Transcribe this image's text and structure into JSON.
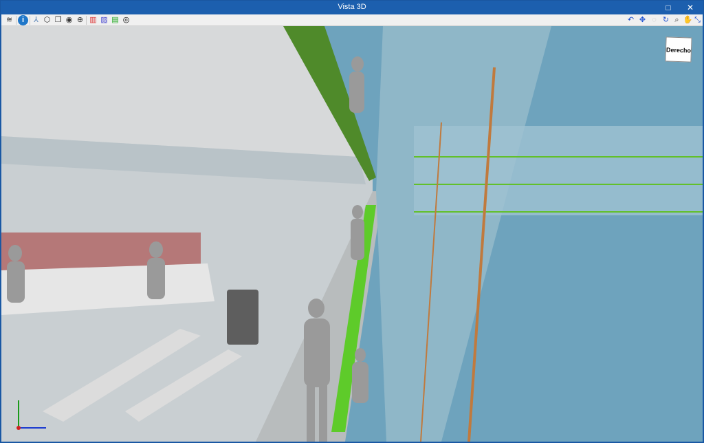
{
  "window": {
    "title": "Vista 3D",
    "maximize_icon": "□",
    "close_icon": "✕"
  },
  "toolbar": {
    "left": [
      {
        "name": "layers-icon",
        "glyph": "≋"
      },
      {
        "name": "info-icon",
        "glyph": "i"
      },
      {
        "name": "axes-icon",
        "glyph": "⅄"
      },
      {
        "name": "box-view-icon",
        "glyph": "⬡"
      },
      {
        "name": "copy-view-icon",
        "glyph": "❐"
      },
      {
        "name": "eye-orbit-icon",
        "glyph": "◉"
      },
      {
        "name": "orbit-icon",
        "glyph": "⊕"
      },
      {
        "name": "section-red-icon",
        "glyph": "▥"
      },
      {
        "name": "section-blue-icon",
        "glyph": "▨"
      },
      {
        "name": "floor-green-icon",
        "glyph": "▤"
      },
      {
        "name": "hide-icon",
        "glyph": "◎"
      }
    ],
    "right": [
      {
        "name": "rotate-zoom-icon",
        "glyph": "↶"
      },
      {
        "name": "zoom-extents-icon",
        "glyph": "✥"
      },
      {
        "name": "zoom-disabled-icon",
        "glyph": "◌"
      },
      {
        "name": "refresh-view-icon",
        "glyph": "↻"
      },
      {
        "name": "zoom-window-icon",
        "glyph": "⌕"
      },
      {
        "name": "pan-hand-icon",
        "glyph": "✋"
      },
      {
        "name": "fit-view-icon",
        "glyph": "⤡"
      }
    ]
  },
  "view_cube": {
    "face": "Derecho"
  }
}
